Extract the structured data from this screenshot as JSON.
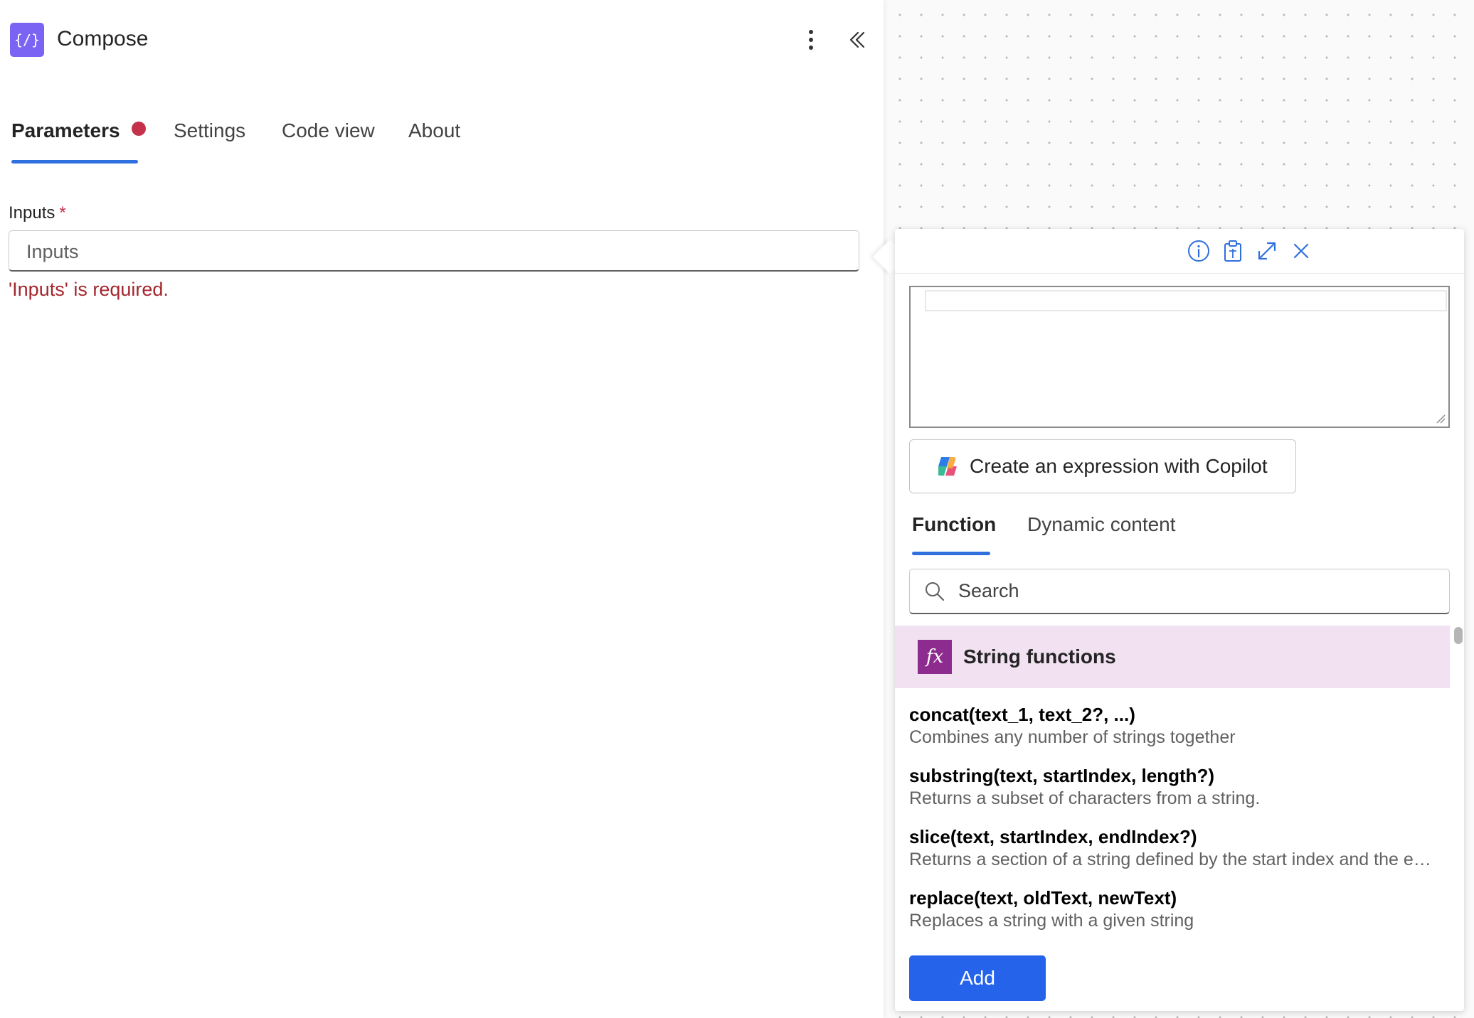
{
  "colors": {
    "accent": "#2f6fde",
    "error": "#c4314b",
    "add_button": "#2563eb",
    "category_bg": "#f1e1f1",
    "fx_icon": "#8e2b8e",
    "app_icon": "#7b64f4"
  },
  "panel": {
    "app_icon": "{/}",
    "title": "Compose",
    "icons": {
      "more": "more-vertical-icon",
      "collapse": "double-chevron-left-icon"
    },
    "tabs": [
      {
        "label": "Parameters",
        "active": true,
        "has_error": true
      },
      {
        "label": "Settings",
        "active": false
      },
      {
        "label": "Code view",
        "active": false
      },
      {
        "label": "About",
        "active": false
      }
    ],
    "inputs": {
      "label": "Inputs",
      "required_mark": "*",
      "placeholder": "Inputs",
      "error": "'Inputs' is required."
    }
  },
  "expression_editor": {
    "toolbar_icons": [
      "info-icon",
      "clipboard-icon",
      "expand-icon",
      "close-icon"
    ],
    "copilot_button": "Create an expression with Copilot",
    "tabs": [
      {
        "label": "Function",
        "active": true
      },
      {
        "label": "Dynamic content",
        "active": false
      }
    ],
    "search_placeholder": "Search",
    "category": {
      "icon": "fx",
      "label": "String functions"
    },
    "functions": [
      {
        "signature": "concat(text_1, text_2?, ...)",
        "description": "Combines any number of strings together"
      },
      {
        "signature": "substring(text, startIndex, length?)",
        "description": "Returns a subset of characters from a string."
      },
      {
        "signature": "slice(text, startIndex, endIndex?)",
        "description": "Returns a section of a string defined by the start index and the en..."
      },
      {
        "signature": "replace(text, oldText, newText)",
        "description": "Replaces a string with a given string"
      }
    ],
    "add_button": "Add"
  }
}
